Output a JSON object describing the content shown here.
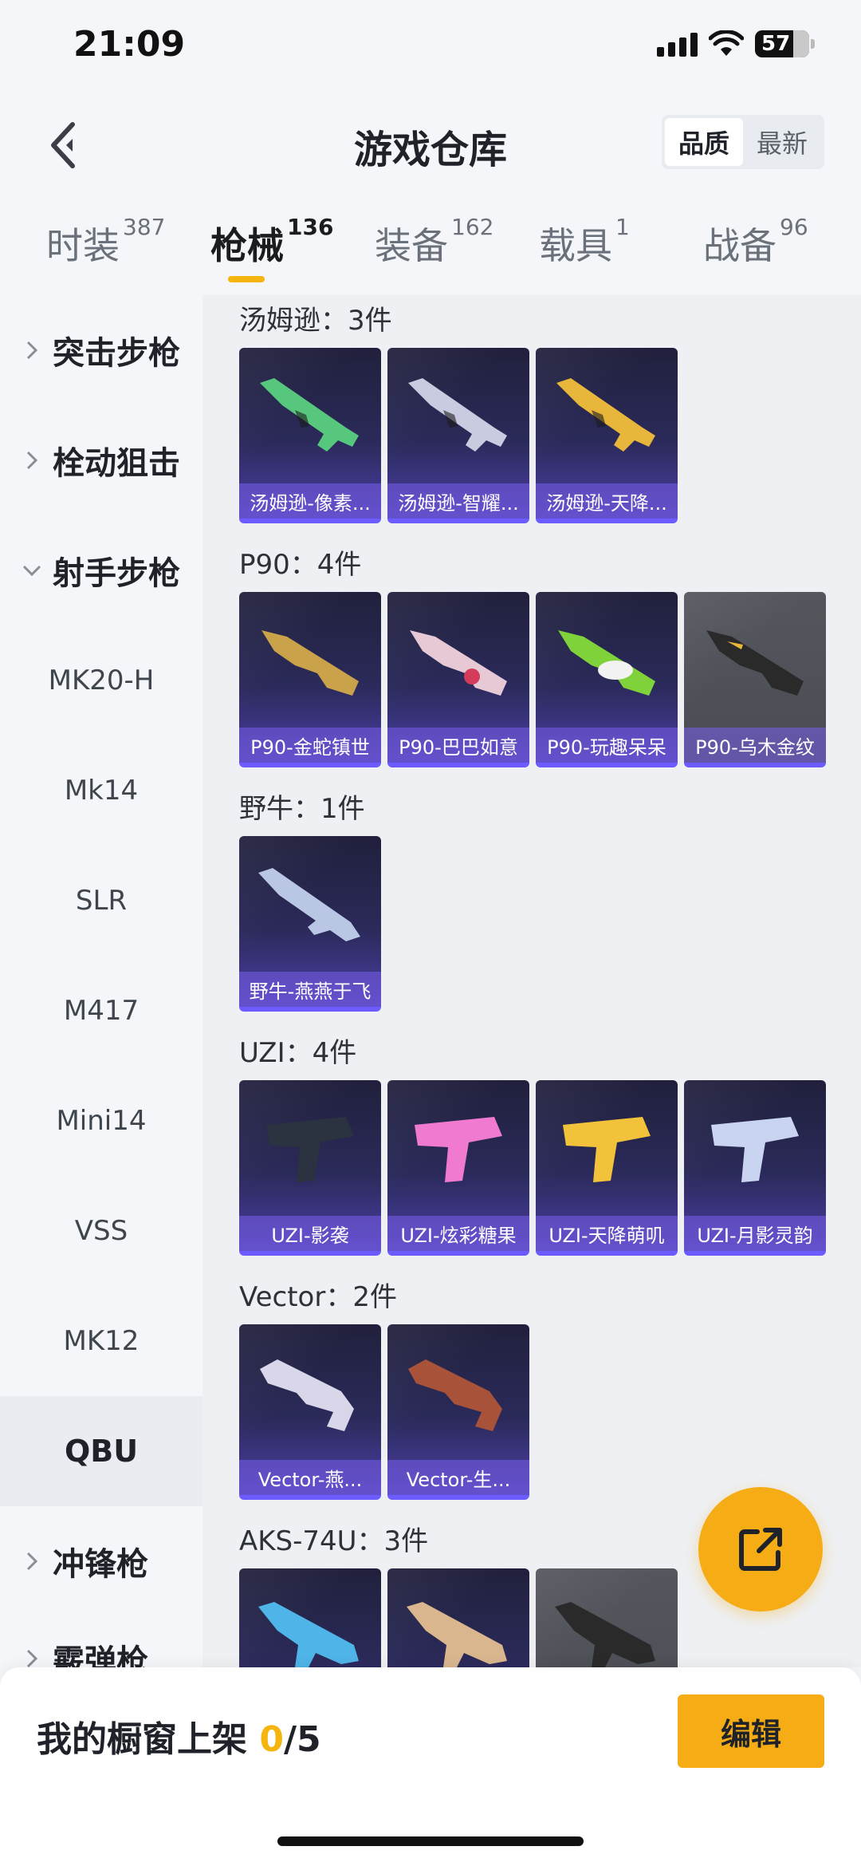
{
  "status_bar": {
    "time": "21:09",
    "battery": "57"
  },
  "header": {
    "title": "游戏仓库",
    "sort_options": [
      "品质",
      "最新"
    ],
    "active_sort": "品质"
  },
  "tabs": [
    {
      "label": "时装",
      "count": "387"
    },
    {
      "label": "枪械",
      "count": "136"
    },
    {
      "label": "装备",
      "count": "162"
    },
    {
      "label": "载具",
      "count": "1"
    },
    {
      "label": "战备",
      "count": "96"
    }
  ],
  "active_tab": "枪械",
  "sidebar": {
    "items": [
      {
        "label": "突击步枪",
        "type": "group",
        "expanded": false
      },
      {
        "label": "栓动狙击",
        "type": "group",
        "expanded": false
      },
      {
        "label": "射手步枪",
        "type": "group",
        "expanded": true
      },
      {
        "label": "MK20-H",
        "type": "item"
      },
      {
        "label": "Mk14",
        "type": "item"
      },
      {
        "label": "SLR",
        "type": "item"
      },
      {
        "label": "M417",
        "type": "item"
      },
      {
        "label": "Mini14",
        "type": "item"
      },
      {
        "label": "VSS",
        "type": "item"
      },
      {
        "label": "MK12",
        "type": "item"
      },
      {
        "label": "QBU",
        "type": "item",
        "selected": true
      },
      {
        "label": "冲锋枪",
        "type": "group",
        "expanded": false
      },
      {
        "label": "霰弹枪",
        "type": "group",
        "expanded": false
      }
    ]
  },
  "sections": [
    {
      "title": "汤姆逊：3件",
      "items": [
        {
          "name": "汤姆逊-像素...",
          "tier": "purple",
          "color": "#58c77e"
        },
        {
          "name": "汤姆逊-智耀...",
          "tier": "purple",
          "color": "#c9cbe0"
        },
        {
          "name": "汤姆逊-天降...",
          "tier": "purple",
          "color": "#e8b63a"
        }
      ]
    },
    {
      "title": "P90：4件",
      "items": [
        {
          "name": "P90-金蛇镇世",
          "tier": "purple",
          "color": "#c9a24a"
        },
        {
          "name": "P90-巴巴如意",
          "tier": "purple",
          "color": "#e7c9d6"
        },
        {
          "name": "P90-玩趣呆呆",
          "tier": "purple",
          "color": "#7fd23a"
        },
        {
          "name": "P90-乌木金纹",
          "tier": "gray",
          "color": "#2a2a2a"
        }
      ]
    },
    {
      "title": "野牛：1件",
      "items": [
        {
          "name": "野牛-燕燕于飞",
          "tier": "purple",
          "color": "#b9c6e4"
        }
      ]
    },
    {
      "title": "UZI：4件",
      "items": [
        {
          "name": "UZI-影袭",
          "tier": "purple",
          "color": "#2b3240"
        },
        {
          "name": "UZI-炫彩糖果",
          "tier": "purple",
          "color": "#f07ad0"
        },
        {
          "name": "UZI-天降萌叽",
          "tier": "purple",
          "color": "#f2c33a"
        },
        {
          "name": "UZI-月影灵韵",
          "tier": "purple",
          "color": "#c8d4f0"
        }
      ]
    },
    {
      "title": "Vector：2件",
      "items": [
        {
          "name": "Vector-燕...",
          "tier": "purple",
          "color": "#d8d6e8"
        },
        {
          "name": "Vector-生...",
          "tier": "purple",
          "color": "#a8523a"
        }
      ]
    },
    {
      "title": "AKS-74U：3件",
      "items": [
        {
          "name": "",
          "tier": "purple",
          "color": "#4fb4e8"
        },
        {
          "name": "",
          "tier": "purple",
          "color": "#d9b68e"
        },
        {
          "name": "",
          "tier": "gray",
          "color": "#2a2a2a"
        }
      ]
    }
  ],
  "bottom_bar": {
    "showcase_label": "我的橱窗上架",
    "showcase_count": "0",
    "showcase_total": "/5",
    "edit_label": "编辑"
  },
  "colors": {
    "accent": "#f6ac14",
    "card_purple": "#4b3fa8",
    "card_gray": "#55575e"
  },
  "icons": {
    "back": "chevron-left-icon",
    "share": "share-external-icon",
    "wifi": "wifi-icon",
    "signal": "signal-icon",
    "battery": "battery-icon"
  }
}
